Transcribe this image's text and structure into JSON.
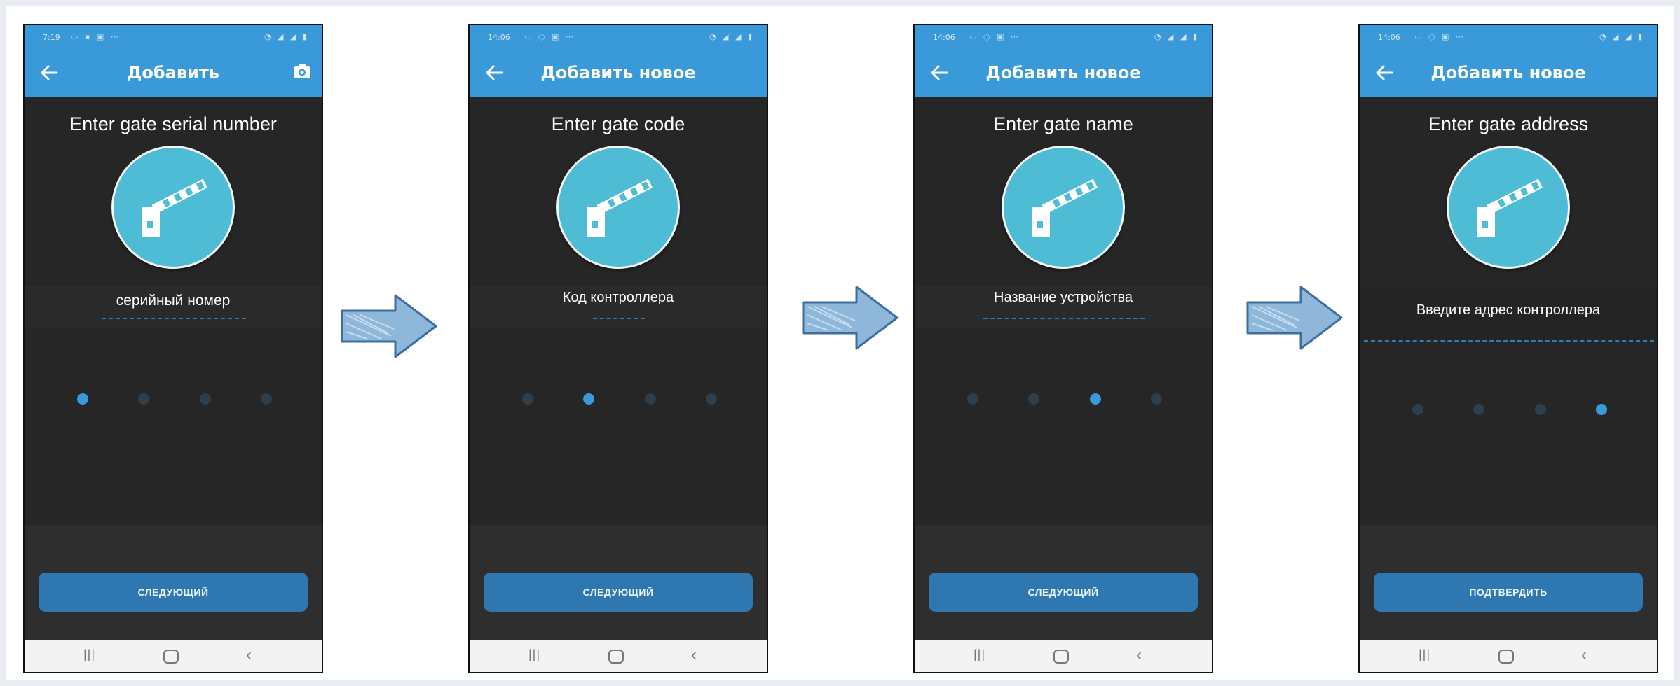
{
  "screens": [
    {
      "status_time": "7:19",
      "title": "Добавить",
      "step_title": "Enter gate serial number",
      "field_text": "серийный номер",
      "active_step": 1,
      "button": "СЛЕДУЮЩИЙ"
    },
    {
      "status_time": "14:06",
      "title": "Добавить новое",
      "step_title": "Enter gate code",
      "field_text": "Код контроллера",
      "active_step": 2,
      "button": "СЛЕДУЮЩИЙ"
    },
    {
      "status_time": "14:06",
      "title": "Добавить новое",
      "step_title": "Enter gate name",
      "field_text": "Название устройства",
      "active_step": 3,
      "button": "СЛЕДУЮЩИЙ"
    },
    {
      "status_time": "14:06",
      "title": "Добавить новое",
      "step_title": "Enter gate address",
      "field_text": "Введите адрес контроллера",
      "active_step": 4,
      "button": "ПОДТВЕРДИТЬ"
    }
  ],
  "colors": {
    "accent": "#3a9ad9",
    "button": "#2f77b0",
    "gate_circle": "#4fbcd6",
    "background_dark": "#262626",
    "arrow_fill": "#8fb7d9"
  },
  "icons": {
    "back": "arrow-left-icon",
    "camera": "camera-icon",
    "gate": "barrier-gate-icon",
    "flow": "right-arrow-icon"
  }
}
